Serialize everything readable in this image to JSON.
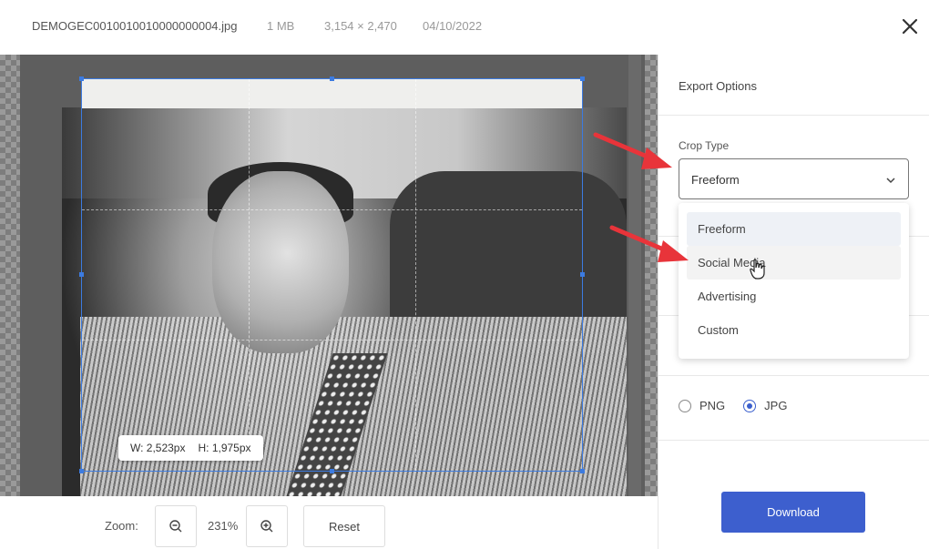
{
  "header": {
    "filename": "DEMOGEC0010010010000000004.jpg",
    "filesize": "1 MB",
    "dimensions": "3,154 × 2,470",
    "date": "04/10/2022",
    "close_icon": "close-icon"
  },
  "editor": {
    "crop_width": "W: 2,523px",
    "crop_height": "H: 1,975px"
  },
  "footer": {
    "zoom_label": "Zoom:",
    "zoom_value": "231%",
    "zoom_out_icon": "zoom-out-icon",
    "zoom_in_icon": "zoom-in-icon",
    "reset_label": "Reset"
  },
  "panel": {
    "title": "Export Options",
    "crop_type_label": "Crop Type",
    "crop_type_value": "Freeform",
    "crop_options": [
      "Freeform",
      "Social Media",
      "Advertising",
      "Custom"
    ],
    "formats": [
      {
        "label": "PNG",
        "checked": false
      },
      {
        "label": "JPG",
        "checked": true
      }
    ],
    "download_label": "Download"
  },
  "colors": {
    "accent": "#3d5fce",
    "crop_border": "#3c7be0",
    "arrow": "#e8343a"
  }
}
